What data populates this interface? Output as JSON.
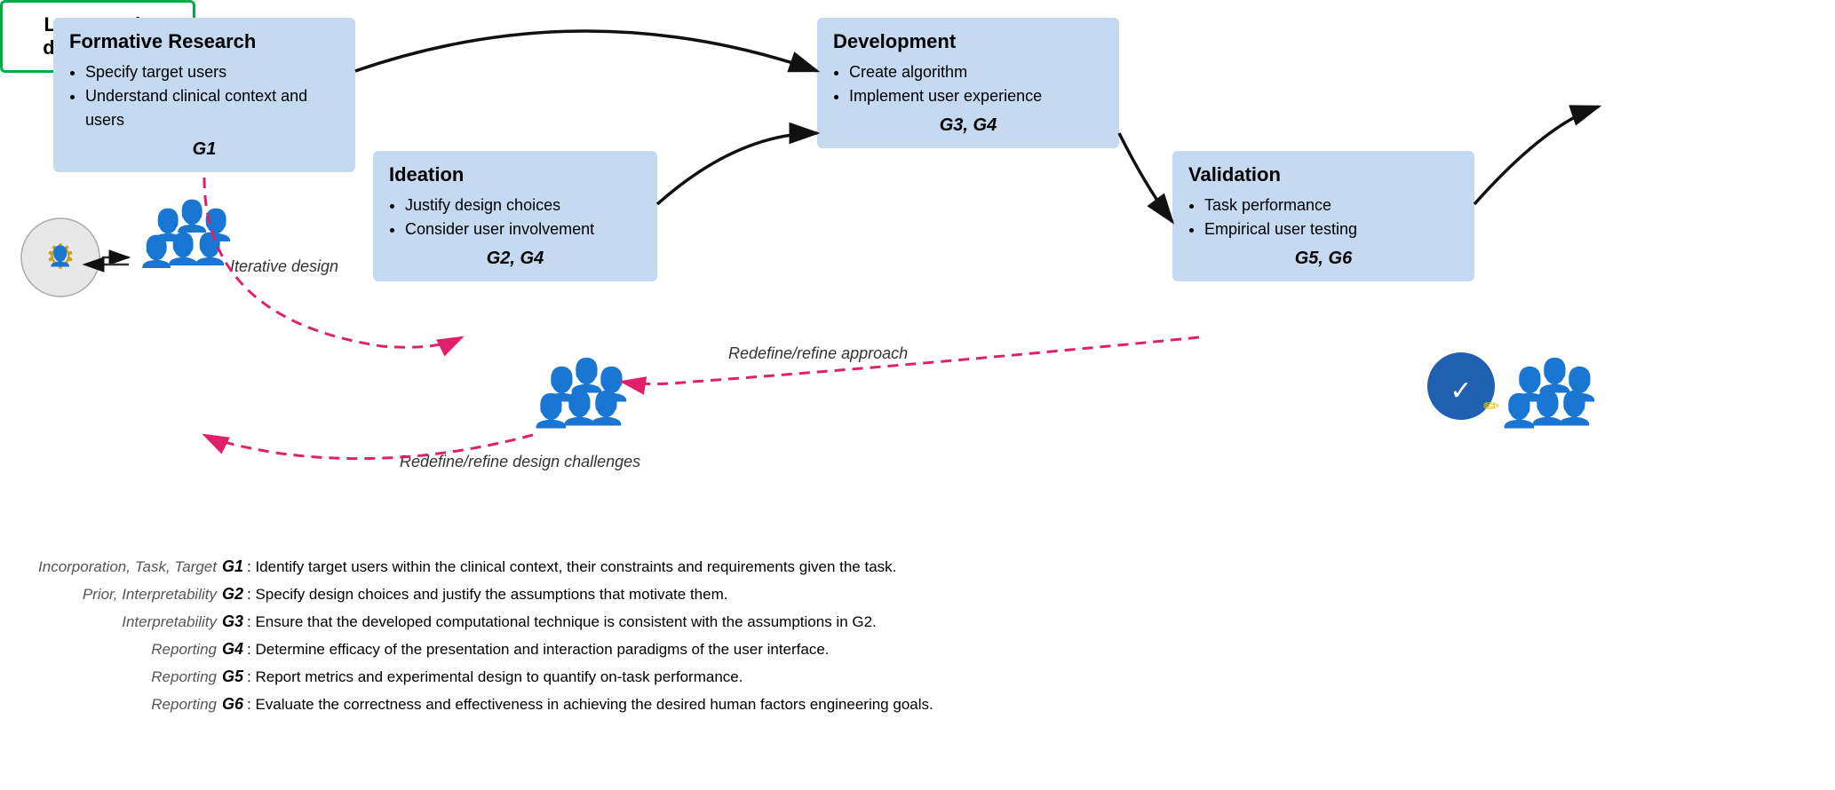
{
  "boxes": {
    "formative": {
      "title": "Formative Research",
      "bullets": [
        "Specify target users",
        "Understand clinical context and users"
      ],
      "guideline": "G1"
    },
    "ideation": {
      "title": "Ideation",
      "bullets": [
        "Justify design choices",
        "Consider user involvement"
      ],
      "guideline": "G2, G4"
    },
    "development": {
      "title": "Development",
      "bullets": [
        "Create algorithm",
        "Implement user experience"
      ],
      "guideline": "G3, G4"
    },
    "validation": {
      "title": "Validation",
      "bullets": [
        "Task performance",
        "Empirical user testing"
      ],
      "guideline": "G5, G6"
    },
    "deployment": {
      "title": "Large scale deployment"
    }
  },
  "labels": {
    "iterative_design": "Iterative design",
    "redefine_approach": "Redefine/refine approach",
    "redefine_design": "Redefine/refine design challenges"
  },
  "legend": [
    {
      "prefix": "Incorporation, Task, Target",
      "gcode": "G1",
      "text": ": Identify target users within the clinical context, their constraints and requirements given the task."
    },
    {
      "prefix": "Prior, Interpretability",
      "gcode": "G2",
      "text": ": Specify design choices and justify the assumptions that motivate them."
    },
    {
      "prefix": "Interpretability",
      "gcode": "G3",
      "text": ": Ensure that the developed computational technique is consistent with the assumptions in G2."
    },
    {
      "prefix": "Reporting",
      "gcode": "G4",
      "text": ": Determine efficacy of the presentation and interaction paradigms of the user interface."
    },
    {
      "prefix": "Reporting",
      "gcode": "G5",
      "text": ": Report metrics and experimental design to quantify on-task performance."
    },
    {
      "prefix": "Reporting",
      "gcode": "G6",
      "text": ": Evaluate the correctness and effectiveness in achieving the desired human factors engineering goals."
    }
  ]
}
